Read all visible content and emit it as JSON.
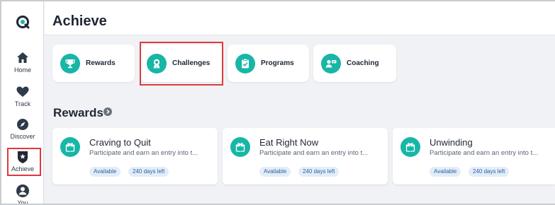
{
  "sidebar": {
    "items": [
      {
        "label": "Home"
      },
      {
        "label": "Track"
      },
      {
        "label": "Discover"
      },
      {
        "label": "Achieve"
      },
      {
        "label": "You"
      }
    ]
  },
  "header": {
    "title": "Achieve"
  },
  "tabs": [
    {
      "label": "Rewards",
      "icon": "trophy-icon"
    },
    {
      "label": "Challenges",
      "icon": "ribbon-icon"
    },
    {
      "label": "Programs",
      "icon": "clipboard-check-icon"
    },
    {
      "label": "Coaching",
      "icon": "coach-icon"
    }
  ],
  "section": {
    "title": "Rewards"
  },
  "cards": [
    {
      "title": "Craving to Quit",
      "description": "Participate and earn an entry into t...",
      "status": "Available",
      "days_left": "240 days left"
    },
    {
      "title": "Eat Right Now",
      "description": "Participate and earn an entry into t...",
      "status": "Available",
      "days_left": "240 days left"
    },
    {
      "title": "Unwinding",
      "description": "Participate and earn an entry into t...",
      "status": "Available",
      "days_left": "240 days left"
    }
  ],
  "colors": {
    "accent": "#17b6a6",
    "highlight": "#e0393e",
    "badge_bg": "#e3edf9",
    "badge_text": "#2f5f9a"
  }
}
